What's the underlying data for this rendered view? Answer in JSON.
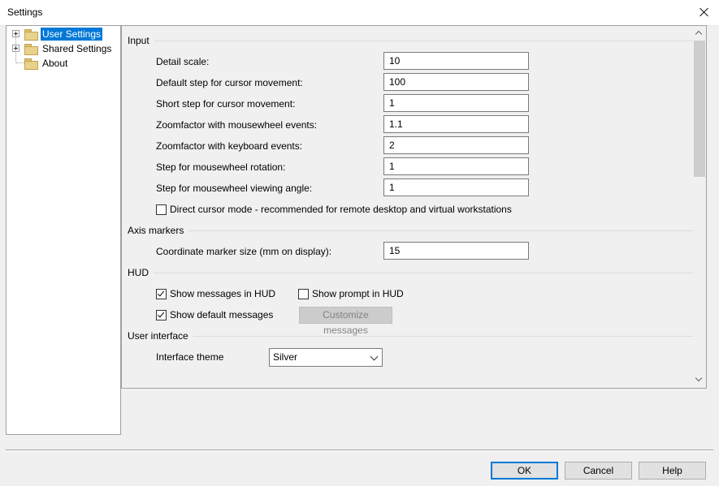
{
  "window": {
    "title": "Settings"
  },
  "tree": {
    "items": [
      {
        "label": "User Settings",
        "selected": true,
        "expandable": true
      },
      {
        "label": "Shared Settings",
        "selected": false,
        "expandable": true
      },
      {
        "label": "About",
        "selected": false,
        "expandable": false
      }
    ]
  },
  "sections": {
    "input": {
      "title": "Input",
      "fields": [
        {
          "label": "Detail scale:",
          "value": "10"
        },
        {
          "label": "Default step for cursor movement:",
          "value": "100"
        },
        {
          "label": "Short step for cursor movement:",
          "value": "1"
        },
        {
          "label": "Zoomfactor with mousewheel events:",
          "value": "1.1"
        },
        {
          "label": "Zoomfactor with keyboard events:",
          "value": "2"
        },
        {
          "label": "Step for mousewheel rotation:",
          "value": "1"
        },
        {
          "label": "Step for mousewheel viewing angle:",
          "value": "1"
        }
      ],
      "direct_cursor": {
        "label": "Direct cursor mode - recommended for remote desktop and virtual workstations",
        "checked": false
      }
    },
    "axis": {
      "title": "Axis markers",
      "field": {
        "label": "Coordinate marker size (mm on display):",
        "value": "15"
      }
    },
    "hud": {
      "title": "HUD",
      "show_messages": {
        "label": "Show messages in HUD",
        "checked": true
      },
      "show_prompt": {
        "label": "Show prompt in HUD",
        "checked": false
      },
      "show_default": {
        "label": "Show default messages",
        "checked": true
      },
      "customize_label": "Customize messages"
    },
    "ui": {
      "title": "User interface",
      "theme_label": "Interface theme",
      "theme_value": "Silver"
    }
  },
  "buttons": {
    "ok": "OK",
    "cancel": "Cancel",
    "help": "Help"
  },
  "colors": {
    "selection": "#0078d7",
    "default_button_border": "#0078d7"
  }
}
